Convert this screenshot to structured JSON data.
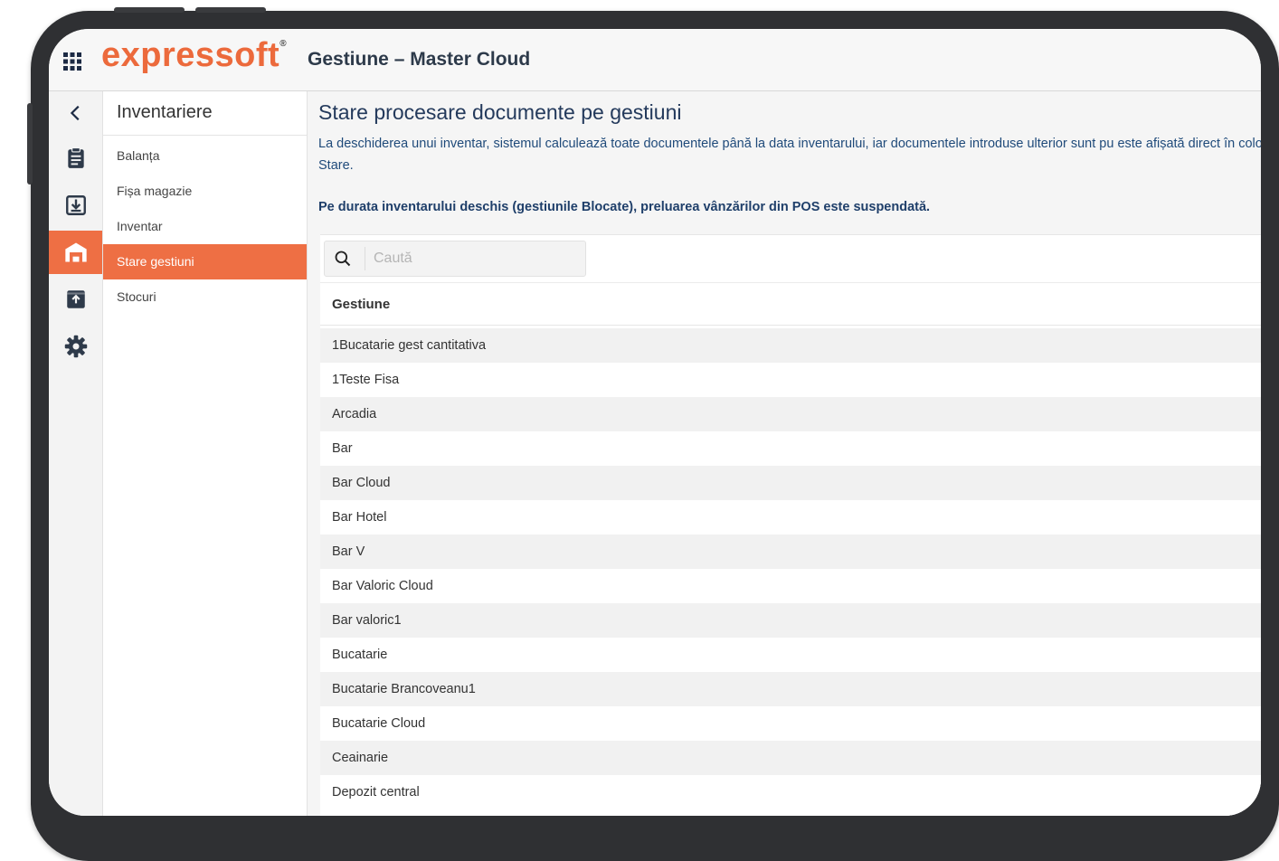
{
  "header": {
    "logo_text": "expressoft",
    "logo_mark": "®",
    "app_title": "Gestiune – Master Cloud",
    "apps_icon": "grid-apps-icon"
  },
  "rail": {
    "items": [
      {
        "icon": "chevron-left-icon"
      },
      {
        "icon": "clipboard-icon"
      },
      {
        "icon": "download-box-icon"
      },
      {
        "icon": "warehouse-icon",
        "active": true
      },
      {
        "icon": "archive-box-icon"
      },
      {
        "icon": "gear-icon"
      }
    ]
  },
  "subnav": {
    "title": "Inventariere",
    "items": [
      {
        "label": "Balanța"
      },
      {
        "label": "Fișa magazie"
      },
      {
        "label": "Inventar"
      },
      {
        "label": "Stare gestiuni",
        "active": true
      },
      {
        "label": "Stocuri"
      }
    ]
  },
  "main": {
    "title": "Stare procesare documente pe gestiuni",
    "description": "La deschiderea unui inventar, sistemul calculează toate documentele până la data inventarului, iar documentele introduse ulterior sunt pu este afișată direct în coloana Stare.",
    "warning": "Pe durata inventarului deschis (gestiunile Blocate), preluarea vânzărilor din POS este suspendată.",
    "search": {
      "placeholder": "Caută",
      "value": ""
    },
    "table": {
      "column_header": "Gestiune",
      "rows": [
        "1Bucatarie gest cantitativa",
        "1Teste Fisa",
        "Arcadia",
        "Bar",
        "Bar Cloud",
        "Bar Hotel",
        "Bar V",
        "Bar Valoric Cloud",
        "Bar valoric1",
        "Bucatarie",
        "Bucatarie Brancoveanu1",
        "Bucatarie Cloud",
        "Ceainarie",
        "Depozit central"
      ]
    }
  },
  "colors": {
    "accent": "#ee6f44",
    "logo": "#ec6a3c",
    "title_text": "#243a5c",
    "description_text": "#1f4a7a"
  }
}
